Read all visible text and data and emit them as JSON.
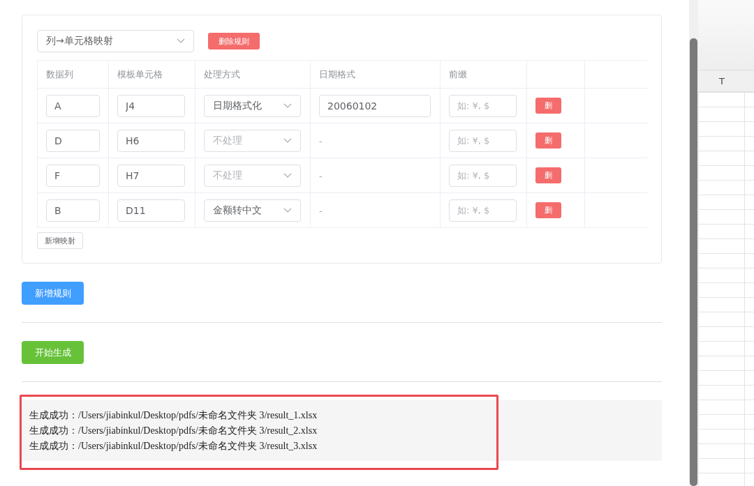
{
  "rule": {
    "type_select": "列→单元格映射",
    "delete_button": "删除规则",
    "table": {
      "columns": [
        "数据列",
        "模板单元格",
        "处理方式",
        "日期格式",
        "前缀"
      ],
      "rows": [
        {
          "data_column": "A",
          "template_cell": "J4",
          "method": {
            "value": "日期格式化"
          },
          "date_format": {
            "kind": "input",
            "value": "20060102"
          },
          "prefix_placeholder": "如: ¥, $",
          "delete": "删"
        },
        {
          "data_column": "D",
          "template_cell": "H6",
          "method": {
            "placeholder": "不处理"
          },
          "date_format": {
            "kind": "text",
            "value": "-"
          },
          "prefix_placeholder": "如: ¥, $",
          "delete": "删"
        },
        {
          "data_column": "F",
          "template_cell": "H7",
          "method": {
            "placeholder": "不处理"
          },
          "date_format": {
            "kind": "text",
            "value": "-"
          },
          "prefix_placeholder": "如: ¥, $",
          "delete": "删"
        },
        {
          "data_column": "B",
          "template_cell": "D11",
          "method": {
            "value": "金额转中文"
          },
          "date_format": {
            "kind": "text",
            "value": "-"
          },
          "prefix_placeholder": "如: ¥, $",
          "delete": "删"
        }
      ]
    },
    "add_mapping": "新增映射"
  },
  "add_rule": "新增规则",
  "start": "开始生成",
  "log": [
    "生成成功：/Users/jiabinkul/Desktop/pdfs/未命名文件夹 3/result_1.xlsx",
    "生成成功：/Users/jiabinkul/Desktop/pdfs/未命名文件夹 3/result_2.xlsx",
    "生成成功：/Users/jiabinkul/Desktop/pdfs/未命名文件夹 3/result_3.xlsx"
  ],
  "spreadsheet": {
    "column_header": "T"
  }
}
